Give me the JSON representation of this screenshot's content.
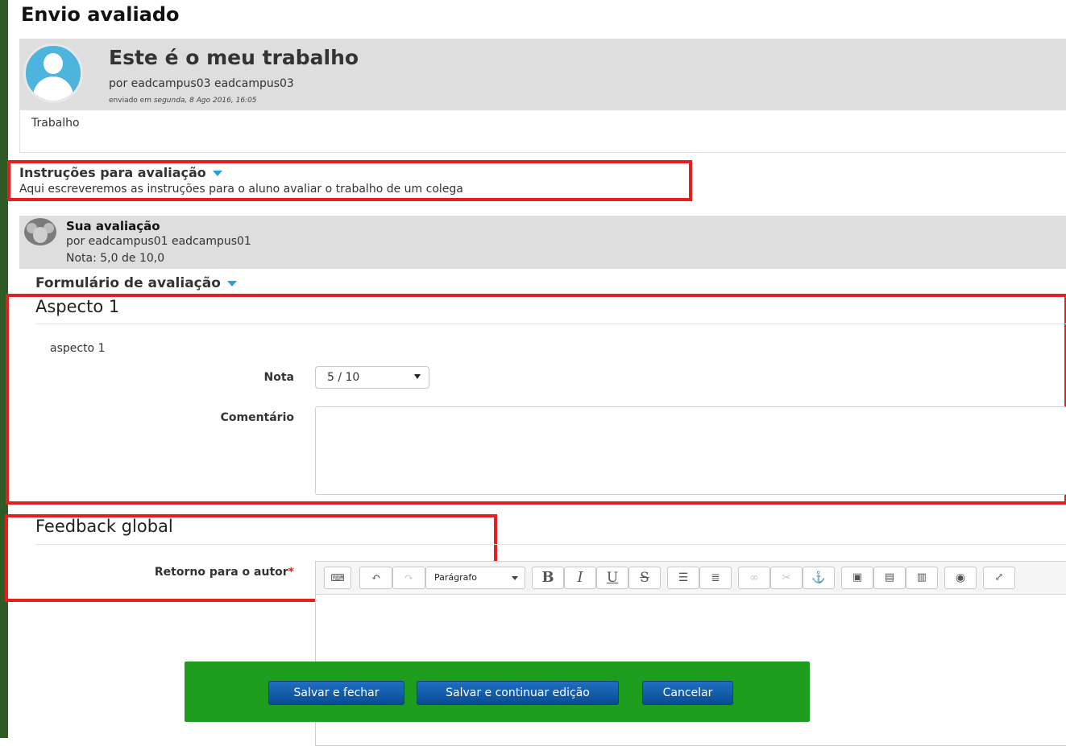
{
  "page": {
    "title": "Envio avaliado"
  },
  "submission": {
    "title": "Este é o meu trabalho",
    "author": "por eadcampus03 eadcampus03",
    "date_prefix": "enviado em",
    "date": "segunda, 8 Ago 2016, 16:05",
    "body": "Trabalho"
  },
  "instructions": {
    "title": "Instruções para avaliação",
    "text": "Aqui escreveremos as instruções para o aluno avaliar o trabalho de um colega"
  },
  "assessment": {
    "title": "Sua avaliação",
    "author": "por eadcampus01 eadcampus01",
    "grade": "Nota: 5,0 de 10,0"
  },
  "form": {
    "title": "Formulário de avaliação",
    "aspect": {
      "title": "Aspecto 1",
      "description": "aspecto 1",
      "grade_label": "Nota",
      "grade_value": "5 / 10",
      "comment_label": "Comentário"
    },
    "feedback": {
      "title": "Feedback global",
      "author_label": "Retorno para o autor",
      "required_mark": "*",
      "editor_toolbar": {
        "paragraph_label": "Parágrafo",
        "bold": "B",
        "italic": "I",
        "underline": "U",
        "strikethrough": "S"
      }
    }
  },
  "actions": {
    "save_close": "Salvar e fechar",
    "save_continue": "Salvar e continuar edição",
    "cancel": "Cancelar"
  },
  "colors": {
    "accent_blue": "#2a9fd6",
    "highlight_red": "#e61e1e",
    "action_bar_green": "#1e9c1e",
    "button_blue": "#0a4c95"
  }
}
